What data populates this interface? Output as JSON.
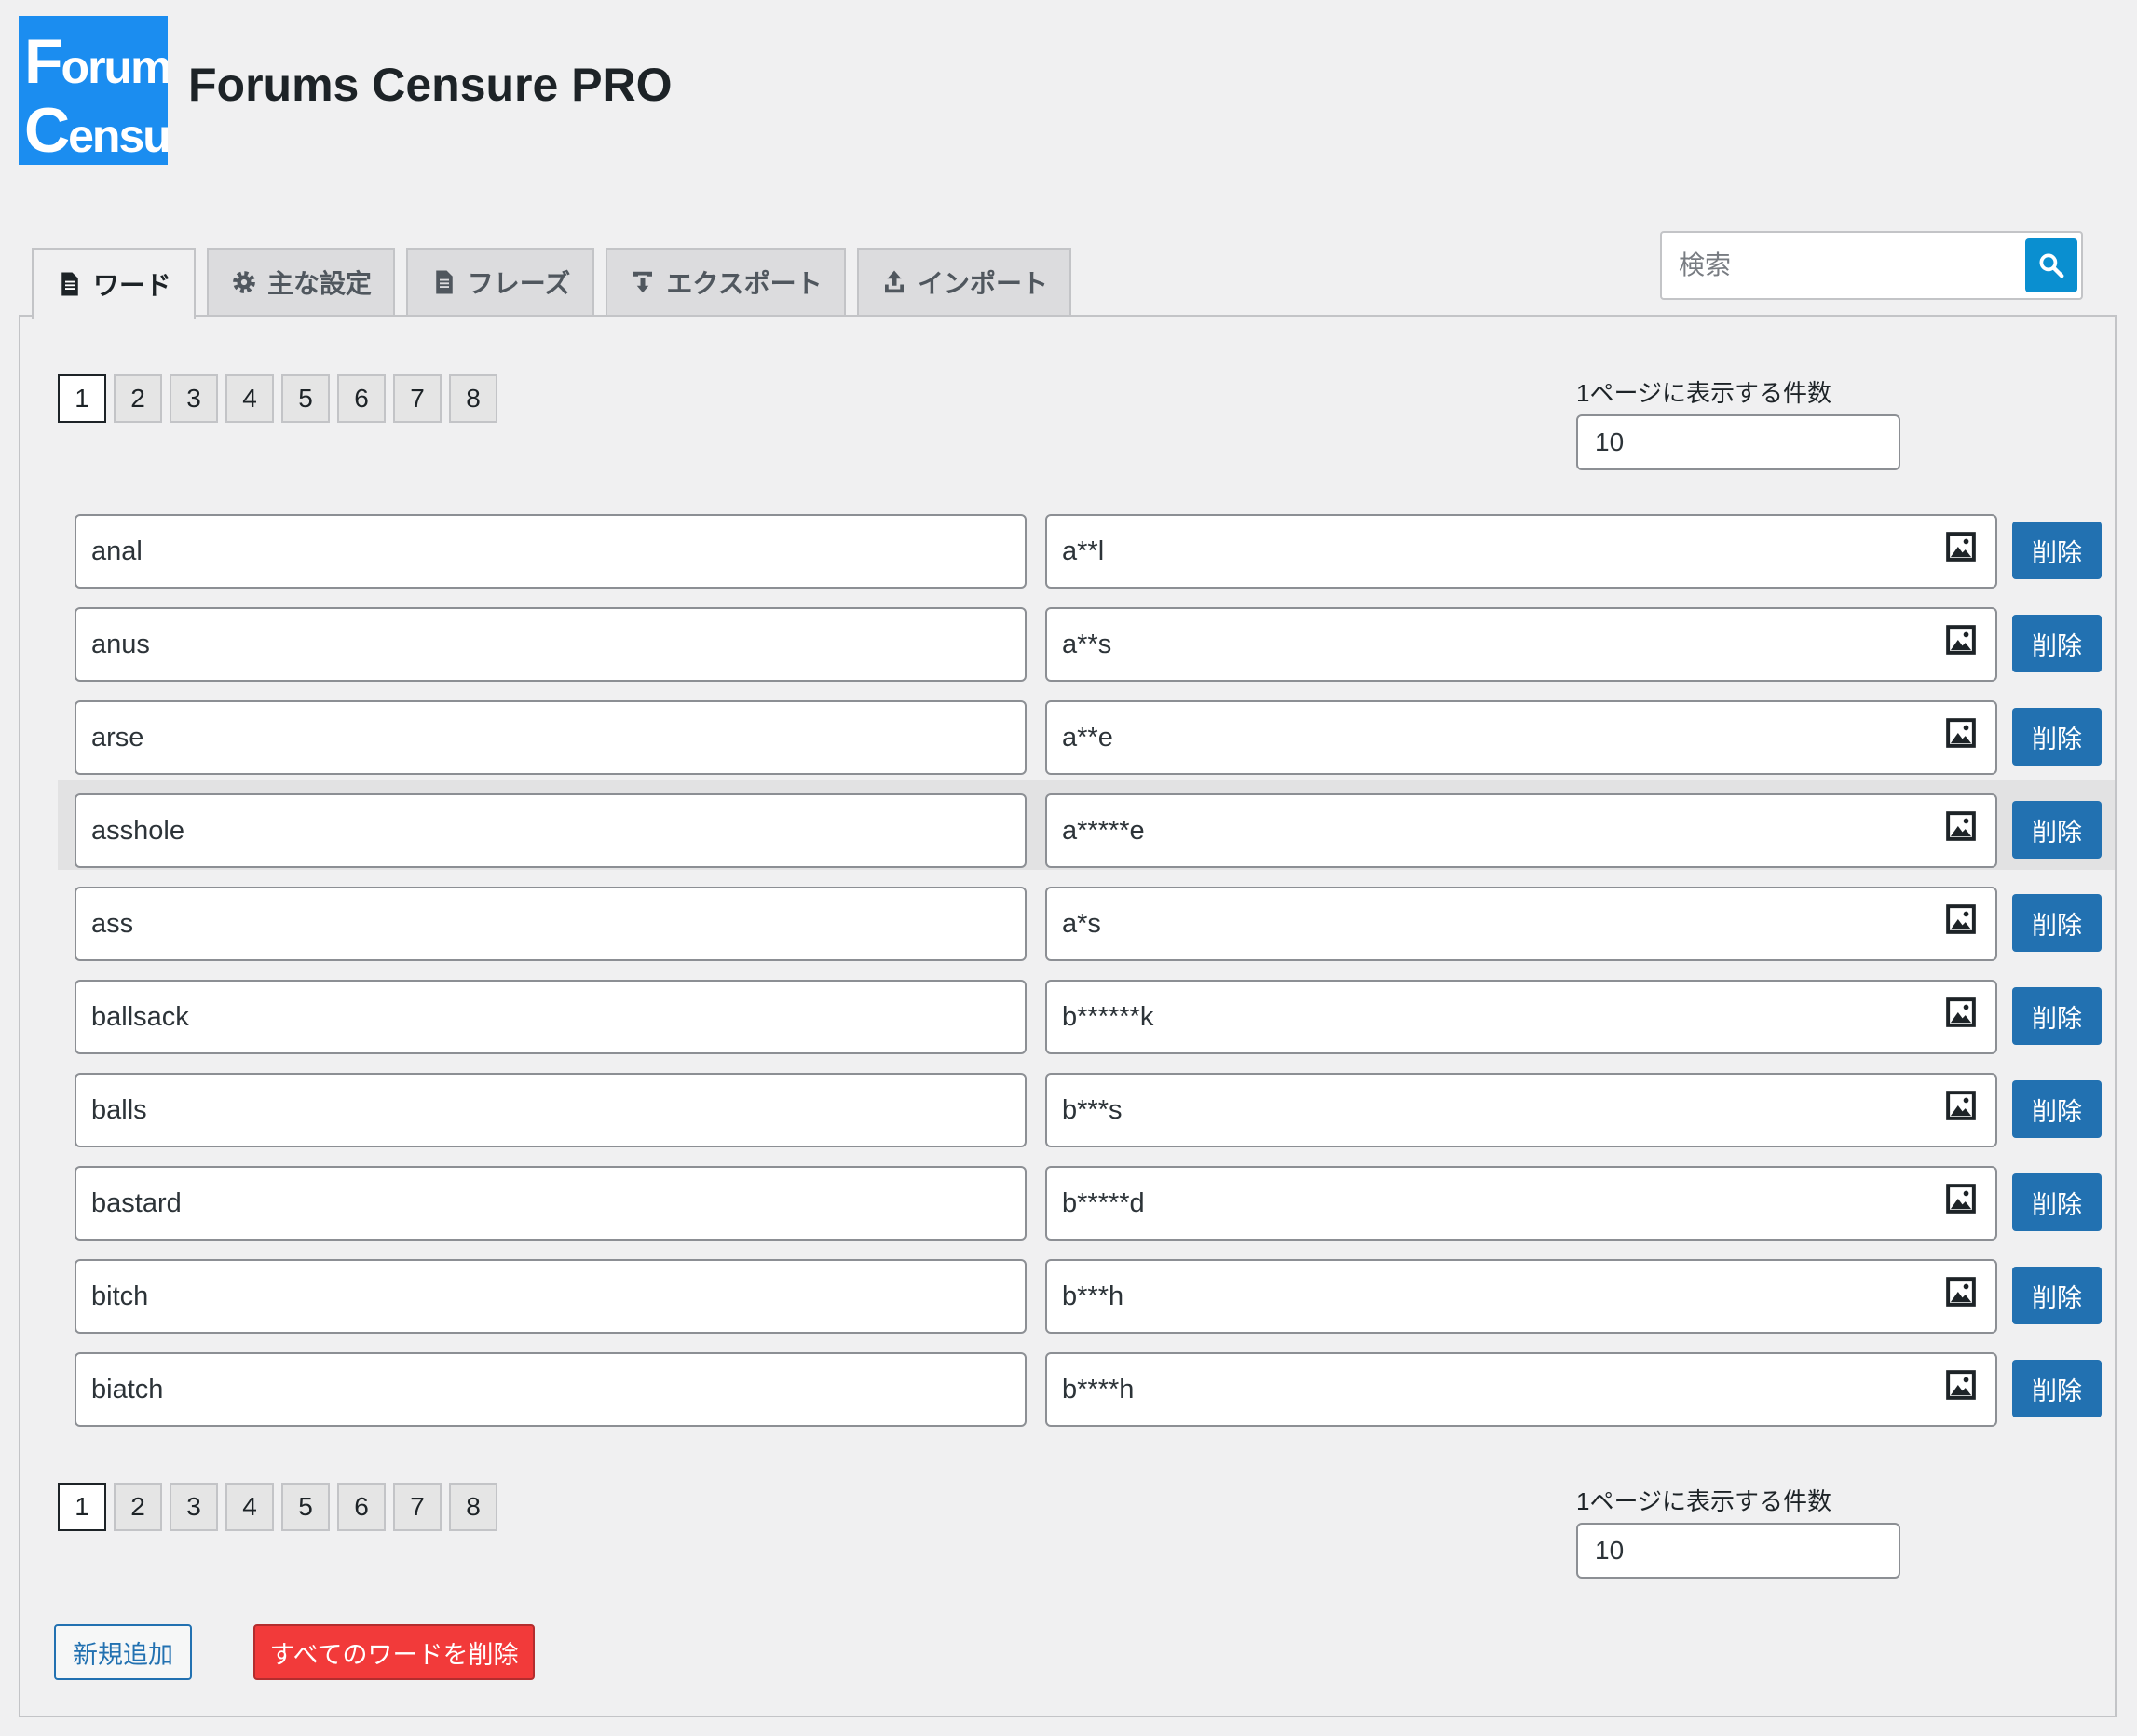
{
  "header": {
    "logo_line1_cap": "F",
    "logo_line1_rest": "orums",
    "logo_line2_cap": "C",
    "logo_line2_rest": "ensure",
    "title": "Forums Censure PRO"
  },
  "tabs": [
    {
      "label": "ワード",
      "icon": "document-icon",
      "active": true
    },
    {
      "label": "主な設定",
      "icon": "gear-icon",
      "active": false
    },
    {
      "label": "フレーズ",
      "icon": "document-icon",
      "active": false
    },
    {
      "label": "エクスポート",
      "icon": "download-icon",
      "active": false
    },
    {
      "label": "インポート",
      "icon": "upload-icon",
      "active": false
    }
  ],
  "search": {
    "placeholder": "検索",
    "icon": "search-icon"
  },
  "pagination": {
    "pages": [
      "1",
      "2",
      "3",
      "4",
      "5",
      "6",
      "7",
      "8"
    ],
    "current": "1"
  },
  "per_page": {
    "label": "1ページに表示する件数",
    "value": "10"
  },
  "words": [
    {
      "word": "anal",
      "replacement": "a**l"
    },
    {
      "word": "anus",
      "replacement": "a**s"
    },
    {
      "word": "arse",
      "replacement": "a**e"
    },
    {
      "word": "asshole",
      "replacement": "a*****e"
    },
    {
      "word": "ass",
      "replacement": "a*s"
    },
    {
      "word": "ballsack",
      "replacement": "b******k"
    },
    {
      "word": "balls",
      "replacement": "b***s"
    },
    {
      "word": "bastard",
      "replacement": "b*****d"
    },
    {
      "word": "bitch",
      "replacement": "b***h"
    },
    {
      "word": "biatch",
      "replacement": "b****h"
    }
  ],
  "row_labels": {
    "delete": "削除",
    "image_icon": "image-icon"
  },
  "footer": {
    "add_new": "新規追加",
    "delete_all": "すべてのワードを削除"
  },
  "colors": {
    "primary": "#2271b1",
    "danger": "#f23a3a",
    "logo_bg": "#1b8df0",
    "search_btn": "#0a8fd0"
  }
}
